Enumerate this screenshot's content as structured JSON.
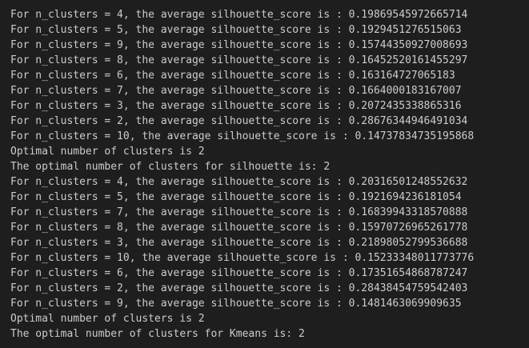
{
  "output": {
    "lines": [
      "For n_clusters = 4, the average silhouette_score is : 0.19869545972665714",
      "For n_clusters = 5, the average silhouette_score is : 0.1929451276515063",
      "For n_clusters = 9, the average silhouette_score is : 0.15744350927008693",
      "For n_clusters = 8, the average silhouette_score is : 0.16452520161455297",
      "For n_clusters = 6, the average silhouette_score is : 0.163164727065183",
      "For n_clusters = 7, the average silhouette_score is : 0.1664000183167007",
      "For n_clusters = 3, the average silhouette_score is : 0.2072435338865316",
      "For n_clusters = 2, the average silhouette_score is : 0.28676344946491034",
      "For n_clusters = 10, the average silhouette_score is : 0.14737834735195868",
      "Optimal number of clusters is 2",
      "The optimal number of clusters for silhouette is: 2",
      "For n_clusters = 4, the average silhouette_score is : 0.20316501248552632",
      "For n_clusters = 5, the average silhouette_score is : 0.1921694236181054",
      "For n_clusters = 7, the average silhouette_score is : 0.16839943318570888",
      "For n_clusters = 8, the average silhouette_score is : 0.15970726965261778",
      "For n_clusters = 3, the average silhouette_score is : 0.21898052799536688",
      "For n_clusters = 10, the average silhouette_score is : 0.15233348011773776",
      "For n_clusters = 6, the average silhouette_score is : 0.17351654868787247",
      "For n_clusters = 2, the average silhouette_score is : 0.28438454759542403",
      "For n_clusters = 9, the average silhouette_score is : 0.1481463069909635",
      "Optimal number of clusters is 2",
      "The optimal number of clusters for Kmeans is: 2"
    ]
  },
  "colors": {
    "background": "#1e1e1e",
    "text": "#cccccc"
  }
}
